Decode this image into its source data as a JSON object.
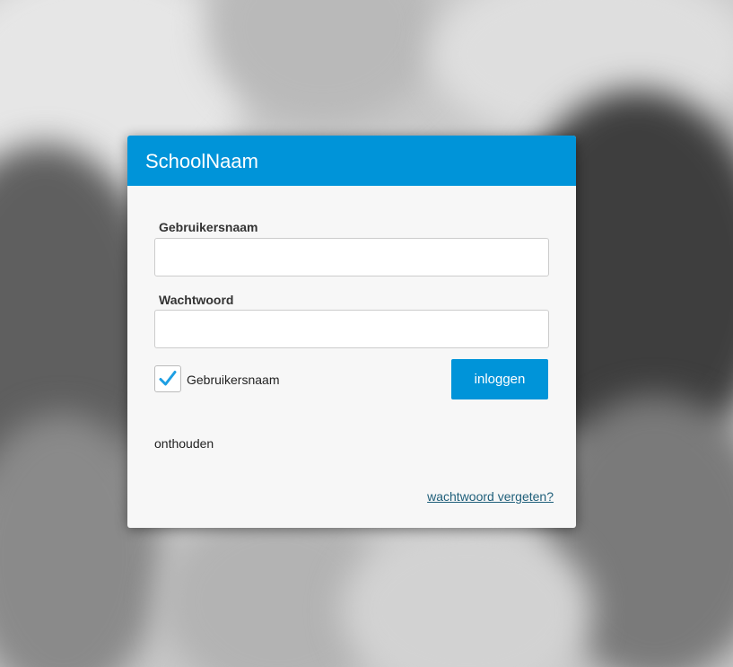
{
  "colors": {
    "brand": "#0094d9",
    "link": "#1f5f7a",
    "checkmark": "#1e9fe3"
  },
  "login": {
    "title": "SchoolNaam",
    "username_label": "Gebruikersnaam",
    "username_value": "",
    "password_label": "Wachtwoord",
    "password_value": "",
    "remember_label": "Gebruikersnaam",
    "remember_label_continued": "onthouden",
    "remember_checked": true,
    "submit_label": "inloggen",
    "forgot_password": "wachtwoord vergeten?"
  },
  "icons": {
    "checkbox": "checkmark-icon"
  }
}
